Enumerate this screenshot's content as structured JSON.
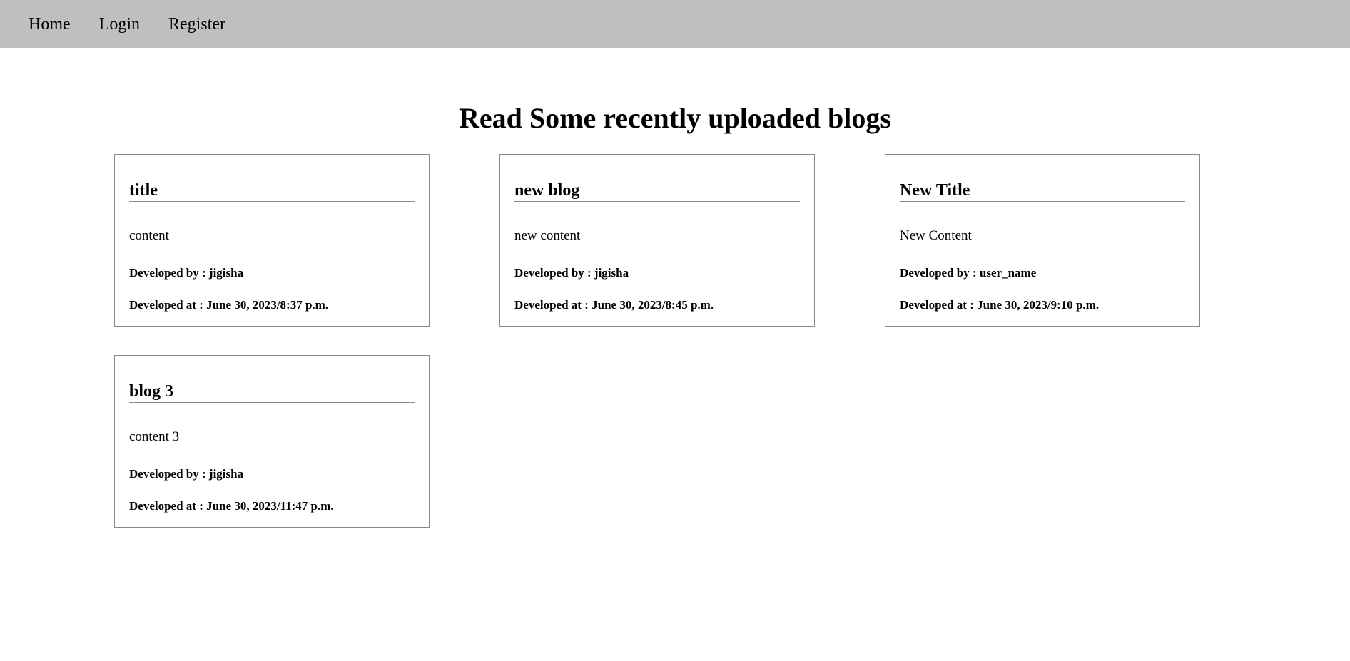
{
  "nav": {
    "items": [
      {
        "label": "Home"
      },
      {
        "label": "Login"
      },
      {
        "label": "Register"
      }
    ]
  },
  "main": {
    "heading": "Read Some recently uploaded blogs",
    "blogs": [
      {
        "title": "title",
        "content": "content",
        "author": "Developed by : jigisha",
        "date": "Developed at : June 30, 2023/8:37 p.m."
      },
      {
        "title": "new blog",
        "content": "new content",
        "author": "Developed by : jigisha",
        "date": "Developed at : June 30, 2023/8:45 p.m."
      },
      {
        "title": "New Title",
        "content": "New Content",
        "author": "Developed by : user_name",
        "date": "Developed at : June 30, 2023/9:10 p.m."
      },
      {
        "title": "blog 3",
        "content": "content 3",
        "author": "Developed by : jigisha",
        "date": "Developed at : June 30, 2023/11:47 p.m."
      }
    ]
  },
  "colors": {
    "navbar_bg": "#bfbfbf",
    "card_border": "#8a8a8a"
  }
}
